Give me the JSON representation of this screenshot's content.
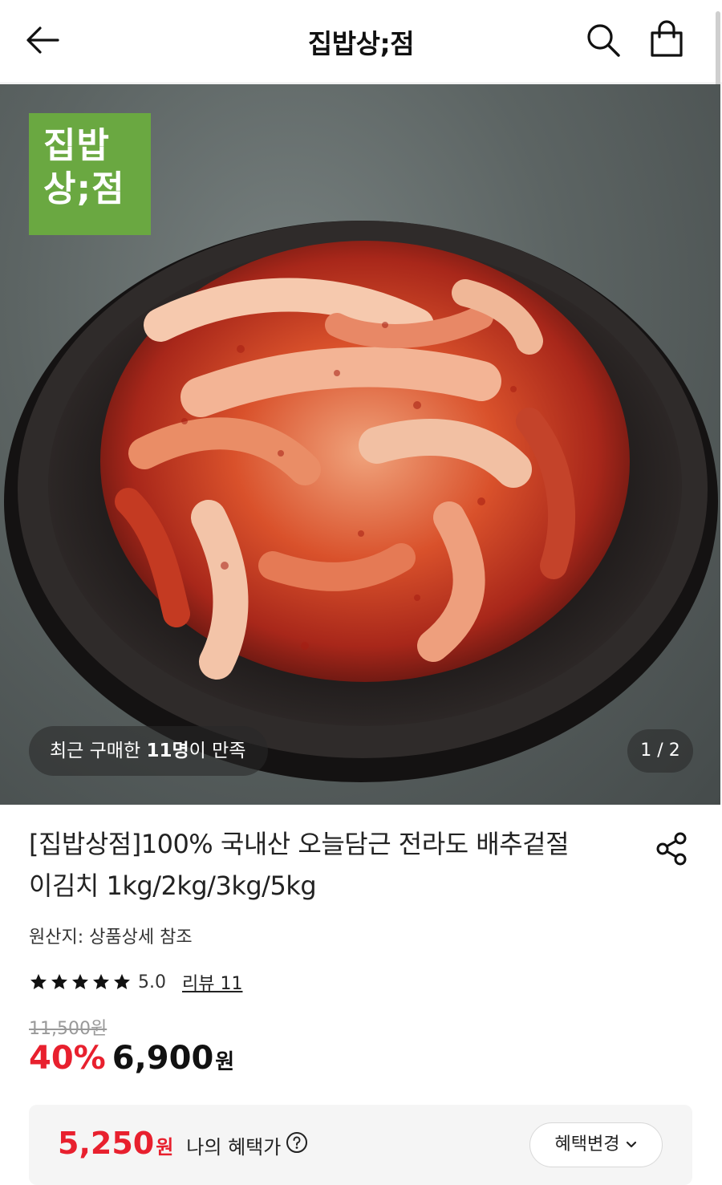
{
  "header": {
    "title": "집밥상;점"
  },
  "icons": {
    "back": "arrow-left-icon",
    "search": "search-icon",
    "cart": "shopping-bag-icon",
    "share": "share-icon",
    "help": "question-circle-icon",
    "chevron": "chevron-down-icon",
    "star": "star-icon"
  },
  "hero": {
    "logo_line1": "집밥",
    "logo_line2": "상;점",
    "satisfaction_prefix": "최근 구매한 ",
    "satisfaction_count": "11명",
    "satisfaction_suffix": "이 만족",
    "page_indicator": "1 / 2"
  },
  "product": {
    "title_line1": "[집밥상점]100% 국내산 오늘담근 전라도 배추겉절",
    "title_line2": "이김치 1kg/2kg/3kg/5kg",
    "origin": "원산지: 상품상세 참조",
    "rating": "5.0",
    "rating_stars": 5,
    "review_link": "리뷰 11",
    "original_price": "11,500원",
    "discount": "40%",
    "sale_price": "6,900",
    "currency": "원"
  },
  "benefit": {
    "amount": "5,250",
    "currency": "원",
    "label": "나의 혜택가",
    "change_button": "혜택변경"
  },
  "colors": {
    "accent_red": "#e8202e",
    "logo_green": "#6aa841"
  }
}
